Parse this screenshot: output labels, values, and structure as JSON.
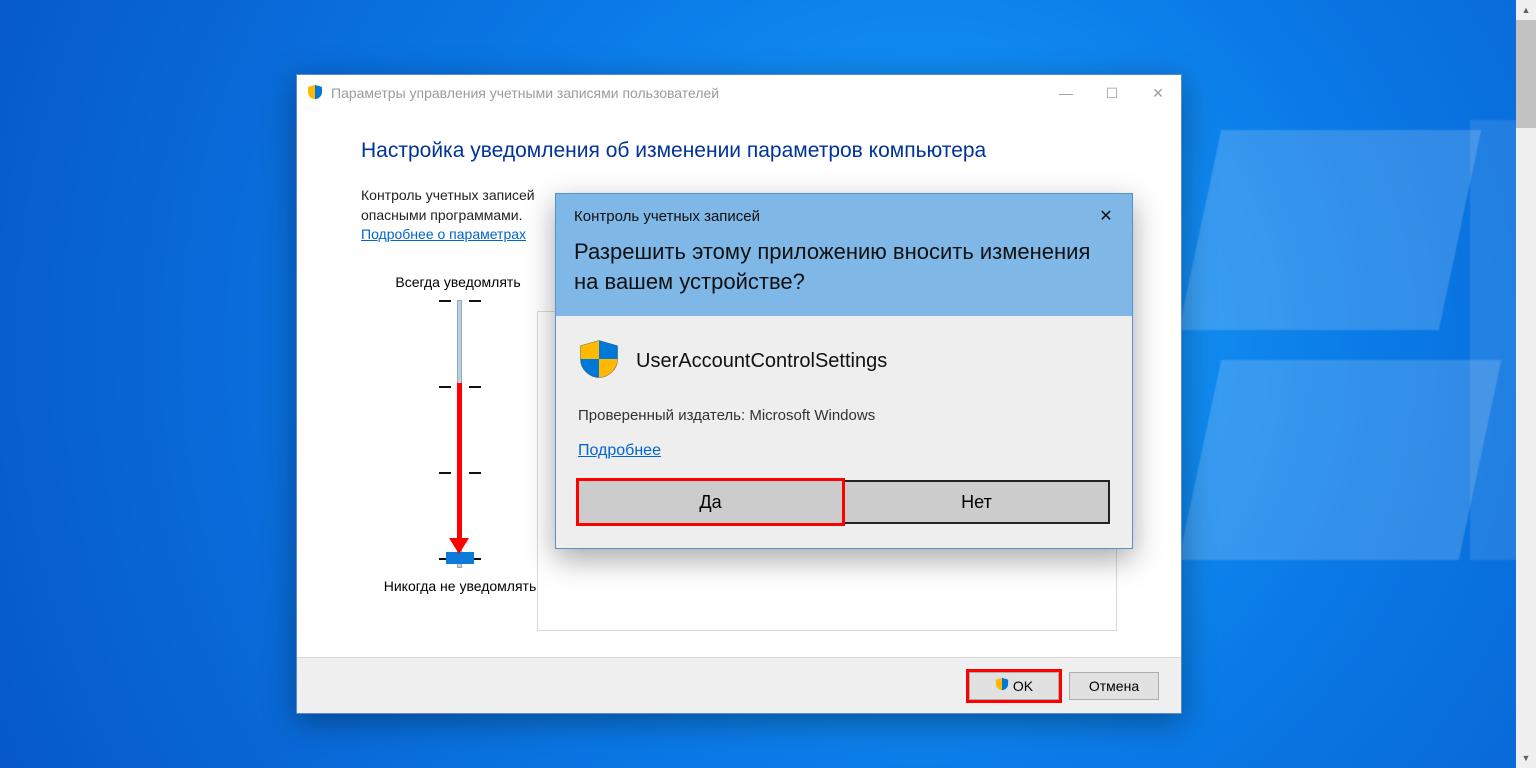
{
  "window": {
    "title": "Параметры управления учетными записями пользователей",
    "page_title": "Настройка уведомления об изменении параметров компьютера",
    "description_line1": "Контроль учетных записей",
    "description_line2": "опасными программами.",
    "details_link": "Подробнее о параметрах",
    "slider_top": "Всегда уведомлять",
    "slider_bottom": "Никогда не уведомлять",
    "ok": "OK",
    "cancel": "Отмена"
  },
  "uac": {
    "small_title": "Контроль учетных записей",
    "question": "Разрешить этому приложению вносить изменения на вашем устройстве?",
    "app_name": "UserAccountControlSettings",
    "publisher": "Проверенный издатель: Microsoft Windows",
    "details": "Подробнее",
    "yes": "Да",
    "no": "Нет"
  }
}
